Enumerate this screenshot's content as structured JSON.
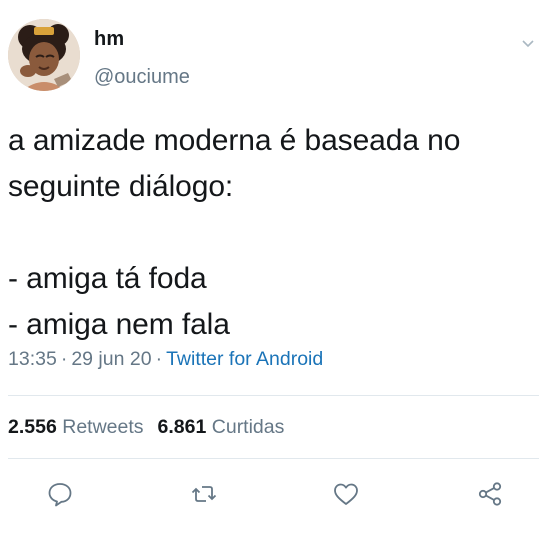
{
  "user": {
    "display_name": "hm",
    "handle": "@ouciume",
    "avatar_icon": "avatar-illustration"
  },
  "tweet": {
    "text": "a amizade moderna é baseada no\nseguinte diálogo:\n\n- amiga tá foda\n- amiga nem fala",
    "time": "13:35",
    "date": "29 jun 20",
    "separator": "·",
    "client": "Twitter for Android"
  },
  "stats": {
    "retweets_count": "2.556",
    "retweets_label": "Retweets",
    "likes_count": "6.861",
    "likes_label": "Curtidas"
  },
  "actions": {
    "reply_icon": "reply-icon",
    "retweet_icon": "retweet-icon",
    "like_icon": "heart-icon",
    "share_icon": "share-icon"
  },
  "colors": {
    "text": "#14171a",
    "secondary": "#657786",
    "link": "#1b74b8",
    "divider": "#e1e8ed"
  }
}
